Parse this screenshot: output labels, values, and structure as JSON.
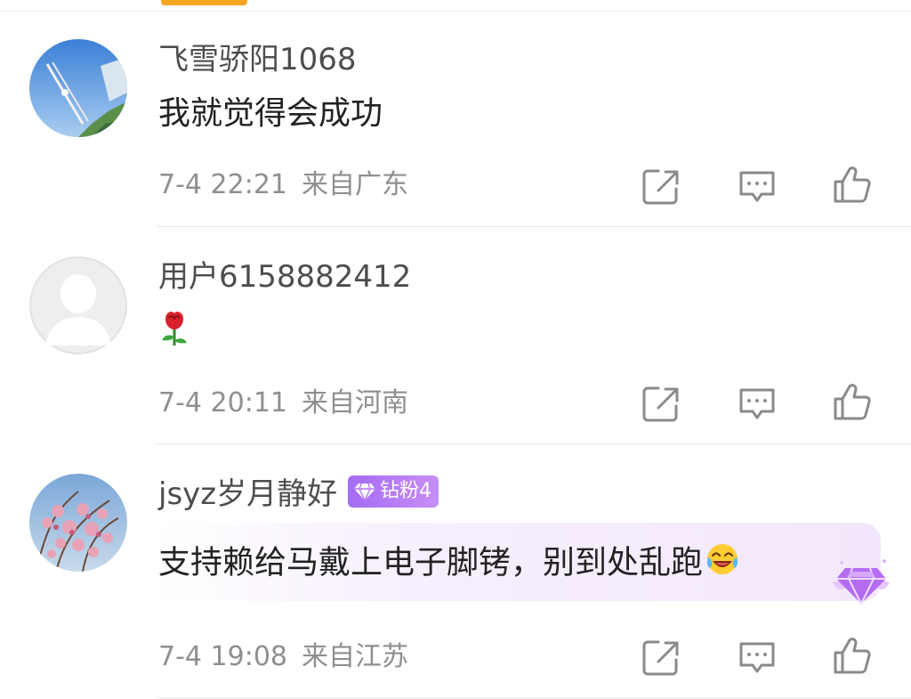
{
  "comments": [
    {
      "username": "飞雪骄阳1068",
      "content": "我就觉得会成功",
      "time": "7-4 22:21",
      "location": "来自广东",
      "avatar": "tower-photo-avatar"
    },
    {
      "username": "用户6158882412",
      "content": "🌹",
      "time": "7-4 20:11",
      "location": "来自河南",
      "avatar": "default-user-avatar"
    },
    {
      "username": "jsyz岁月静好",
      "badge": "钻粉4",
      "content": "支持赖给马戴上电子脚铐，别到处乱跑",
      "time": "7-4 19:08",
      "location": "来自江苏",
      "avatar": "blossom-photo-avatar"
    }
  ],
  "icons": {
    "share": "share-icon",
    "reply": "reply-icon",
    "like": "like-icon",
    "laugh": "laughing-emoji-icon",
    "diamond": "diamond-icon"
  },
  "colors": {
    "badge": "#b27af5",
    "meta": "#8f8f8f",
    "accent_top": "#f5a623"
  }
}
